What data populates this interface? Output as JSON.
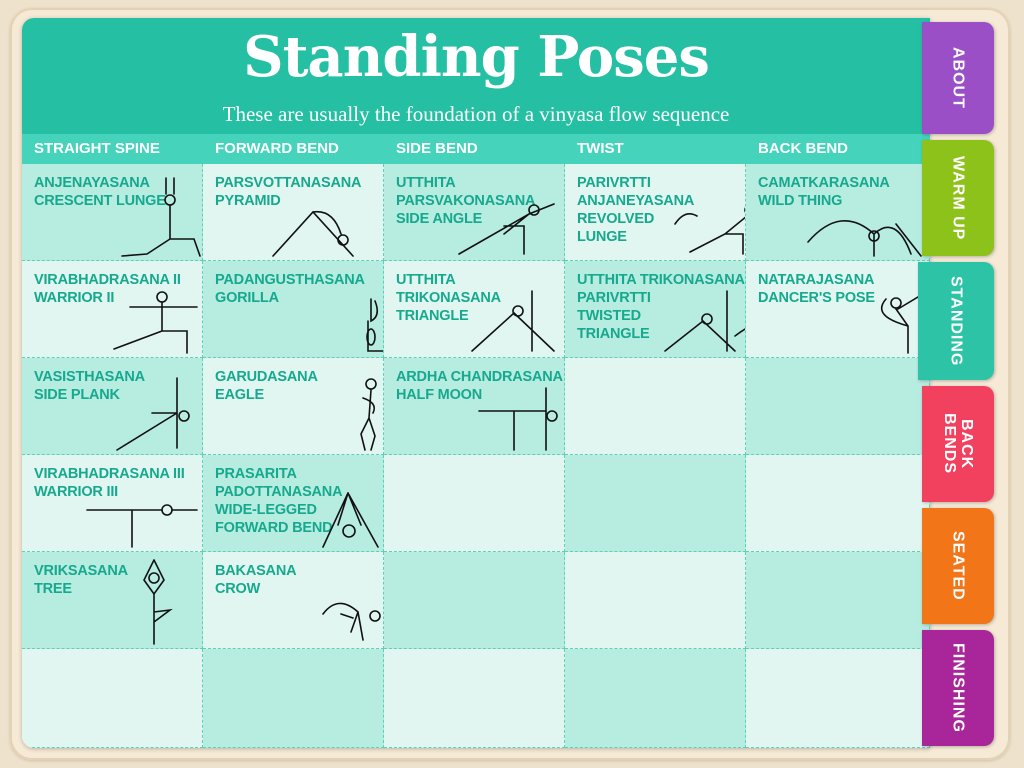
{
  "page": {
    "title": "Standing Poses",
    "subtitle": "These are usually the foundation of a vinyasa flow sequence"
  },
  "columns": [
    "STRAIGHT SPINE",
    "FORWARD BEND",
    "SIDE BEND",
    "TWIST",
    "BACK BEND"
  ],
  "poses": {
    "anjenayasana": [
      "ANJENAYASANA",
      "CRESCENT LUNGE"
    ],
    "parsvottanasana": [
      "PARSVOTTANASANA",
      "PYRAMID"
    ],
    "parsvakonasana": [
      "UTTHITA",
      "PARSVAKONASANA",
      "SIDE ANGLE"
    ],
    "revolved_lunge": [
      "PARIVRTTI",
      "ANJANEYASANA",
      "REVOLVED",
      "LUNGE"
    ],
    "camatkarasana": [
      "CAMATKARASANA",
      "WILD THING"
    ],
    "warrior2": [
      "VIRABHADRASANA II",
      "WARRIOR II"
    ],
    "padangusthasana": [
      "PADANGUSTHASANA",
      "GORILLA"
    ],
    "triangle": [
      "UTTHITA",
      "TRIKONASANA",
      "TRIANGLE"
    ],
    "twisted_triangle": [
      "UTTHITA TRIKONASANA",
      "PARIVRTTI",
      "TWISTED",
      "TRIANGLE"
    ],
    "natarajasana": [
      "NATARAJASANA",
      "DANCER'S POSE"
    ],
    "vasisthasana": [
      "VASISTHASANA",
      "SIDE PLANK"
    ],
    "garudasana": [
      "GARUDASANA",
      "EAGLE"
    ],
    "half_moon": [
      "ARDHA CHANDRASANA",
      "HALF MOON"
    ],
    "warrior3": [
      "VIRABHADRASANA III",
      "WARRIOR III"
    ],
    "wide_legged": [
      "PRASARITA",
      "PADOTTANASANA",
      "WIDE-LEGGED",
      "FORWARD BEND"
    ],
    "tree": [
      "VRIKSASANA",
      "TREE"
    ],
    "crow": [
      "BAKASANA",
      "CROW"
    ]
  },
  "tabs": [
    {
      "label": "ABOUT",
      "color": "#9a4fc7"
    },
    {
      "label": "WARM UP",
      "color": "#8cc21a"
    },
    {
      "label": "STANDING",
      "color": "#2cc3a6"
    },
    {
      "label": "BACK\nBENDS",
      "color": "#f2405f"
    },
    {
      "label": "SEATED",
      "color": "#f27518"
    },
    {
      "label": "FINISHING",
      "color": "#a8259a"
    }
  ],
  "colors": {
    "header": "#25bfa3",
    "column_header": "#45d3bb",
    "cell_dark": "#b7ece1",
    "cell_light": "#e1f6f1",
    "label": "#16a98e"
  }
}
